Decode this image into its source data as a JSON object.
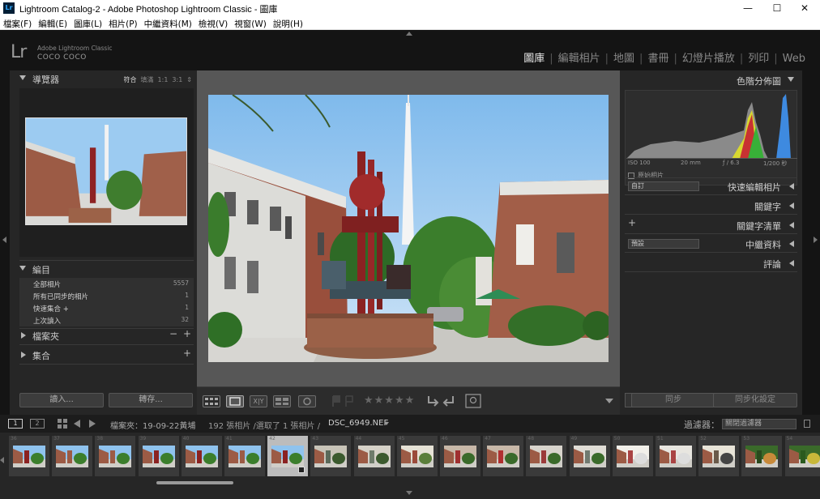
{
  "window": {
    "title": "Lightroom Catalog-2 - Adobe Photoshop Lightroom Classic - 圖庫",
    "app_icon": "Lr",
    "minimize": "—",
    "maximize": "☐",
    "close": "✕"
  },
  "menu": [
    "檔案(F)",
    "編輯(E)",
    "圖庫(L)",
    "相片(P)",
    "中繼資料(M)",
    "檢視(V)",
    "視窗(W)",
    "說明(H)"
  ],
  "identity": {
    "logo": "Lr",
    "app_name": "Adobe Lightroom Classic",
    "user": "COCO COCO"
  },
  "modules": {
    "items": [
      "圖庫",
      "編輯相片",
      "地圖",
      "書冊",
      "幻燈片播放",
      "列印",
      "Web"
    ],
    "active": "圖庫",
    "separator": "|"
  },
  "navigator": {
    "title": "導覽器",
    "zoom_options": [
      "符合",
      "填滿",
      "1:1",
      "3:1"
    ],
    "selected_zoom": "符合",
    "zoom_dropdown": "⇕"
  },
  "catalog": {
    "title": "編目",
    "rows": [
      {
        "name": "全部相片",
        "count": "5557"
      },
      {
        "name": "所有已同步的相片",
        "count": "1"
      },
      {
        "name": "快速集合 +",
        "count": "1"
      },
      {
        "name": "上次讀入",
        "count": "32"
      }
    ]
  },
  "folders": {
    "title": "檔案夾",
    "minus": "−",
    "plus": "+"
  },
  "collections": {
    "title": "集合",
    "plus": "+"
  },
  "left_buttons": {
    "import": "讀入...",
    "export": "轉存..."
  },
  "histogram": {
    "title": "色階分佈圖",
    "iso": "ISO 100",
    "focal": "20 mm",
    "aperture": "ƒ / 6.3",
    "shutter": "1/200 秒",
    "original_photo": "原始相片"
  },
  "quick_develop": {
    "preset": "自訂",
    "title": "快速編輯相片"
  },
  "keywording": {
    "title": "關鍵字"
  },
  "keyword_list": {
    "plus": "+",
    "title": "關鍵字清單"
  },
  "metadata": {
    "preset": "預設",
    "title": "中繼資料"
  },
  "comments": {
    "title": "評論"
  },
  "right_buttons": {
    "sync": "同步",
    "sync_settings": "同步化設定"
  },
  "toolbar": {
    "stars": "★★★★★",
    "grid_icon": "grid-icon",
    "loupe_icon": "loupe-icon",
    "compare_label": "X|Y",
    "survey_icon": "survey-icon",
    "people_icon": "people-icon"
  },
  "filmstrip_header": {
    "screen1": "1",
    "screen2": "2",
    "source": "檔案夾：19-09-22黃埔",
    "count": "192 張相片 /選取了 1 張相片 /",
    "filename": "DSC_6949.NEF",
    "filter_label": "過濾器：",
    "filter_value": "關閉過濾器"
  },
  "filmstrip": {
    "numbers": [
      "36",
      "37",
      "38",
      "39",
      "40",
      "41",
      "42",
      "43",
      "44",
      "45",
      "46",
      "47",
      "48",
      "49",
      "50",
      "51",
      "52",
      "53",
      "54"
    ]
  },
  "colors": {
    "sky": "#8fc3ee",
    "brick": "#8d4a36",
    "tree": "#3e7d2f",
    "accent_red": "#9b2626"
  }
}
